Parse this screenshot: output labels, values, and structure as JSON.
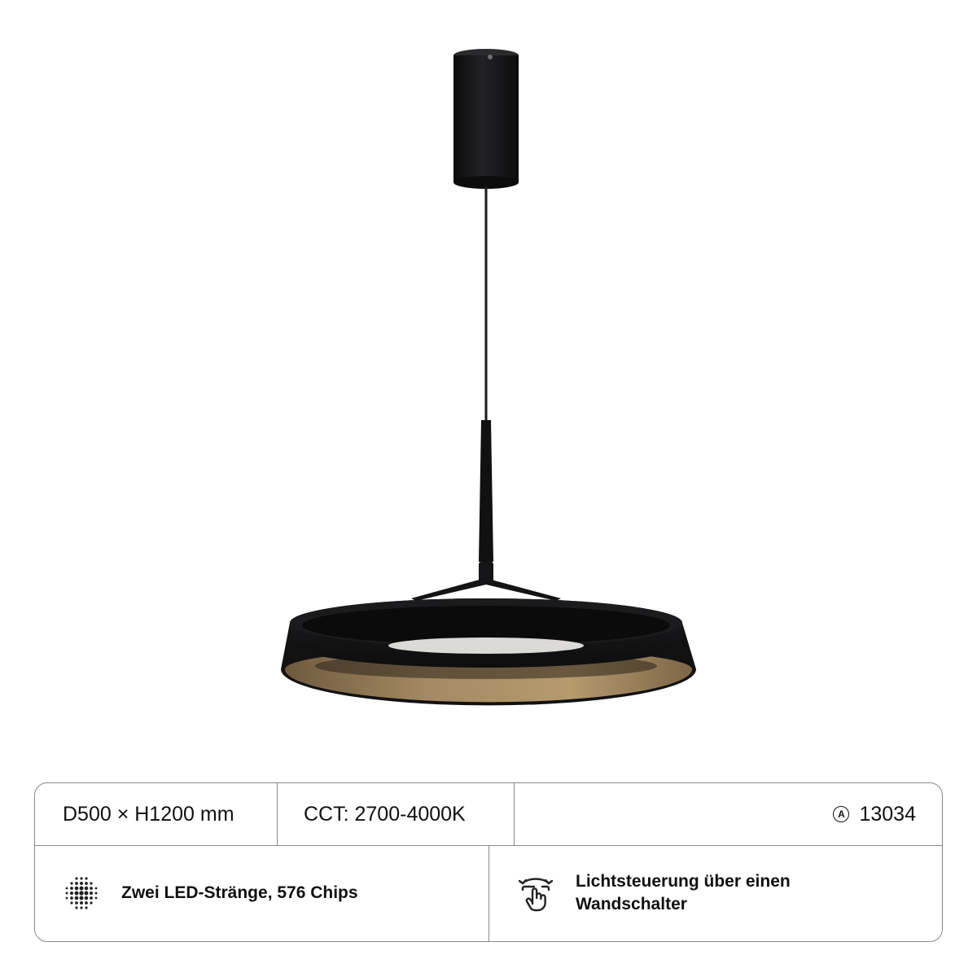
{
  "specs": {
    "dimensions": "D500 × H1200 mm",
    "cct": "CCT: 2700-4000K",
    "article_mark": "A",
    "article_number": "13034"
  },
  "features": [
    {
      "icon": "led-dots-icon",
      "text": "Zwei LED-Stränge, 576 Chips"
    },
    {
      "icon": "wall-switch-hand-icon",
      "line1": "Lichtsteuerung über einen",
      "line2": "Wandschalter"
    }
  ],
  "colors": {
    "lamp_body": "#141416",
    "ring_inner": "#a08560",
    "border": "#8a8a8a"
  }
}
